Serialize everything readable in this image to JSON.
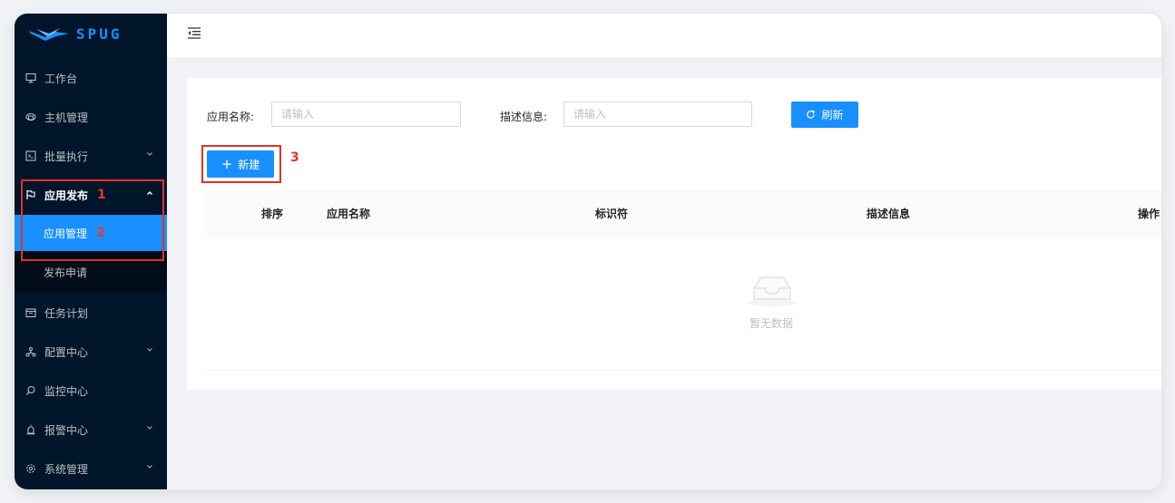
{
  "brand": {
    "name": "SPUG"
  },
  "menu": {
    "workbench": {
      "label": "工作台",
      "icon": "desktop-icon"
    },
    "hosts": {
      "label": "主机管理",
      "icon": "cloud-server-icon"
    },
    "batch": {
      "label": "批量执行",
      "icon": "terminal-icon"
    },
    "deploy": {
      "label": "应用发布",
      "icon": "flag-icon",
      "annotation": "1",
      "children": [
        {
          "label": "应用管理",
          "annotation": "2",
          "active": true
        },
        {
          "label": "发布申请"
        }
      ]
    },
    "schedule": {
      "label": "任务计划",
      "icon": "calendar-icon"
    },
    "config": {
      "label": "配置中心",
      "icon": "cluster-icon"
    },
    "monitor": {
      "label": "监控中心",
      "icon": "monitor-search-icon"
    },
    "alarm": {
      "label": "报警中心",
      "icon": "alarm-icon"
    },
    "system": {
      "label": "系统管理",
      "icon": "settings-icon"
    }
  },
  "filters": {
    "app_name_label": "应用名称:",
    "app_name_placeholder": "请输入",
    "desc_label": "描述信息:",
    "desc_placeholder": "请输入",
    "refresh_label": "刷新"
  },
  "toolbar": {
    "new_label": "新建",
    "annotation": "3"
  },
  "table": {
    "columns": [
      "排序",
      "应用名称",
      "标识符",
      "描述信息",
      "操作"
    ],
    "rows": [],
    "empty_text": "暂无数据"
  },
  "colors": {
    "primary": "#1890ff",
    "sidebar": "#001529",
    "annotation": "#e8372c"
  }
}
